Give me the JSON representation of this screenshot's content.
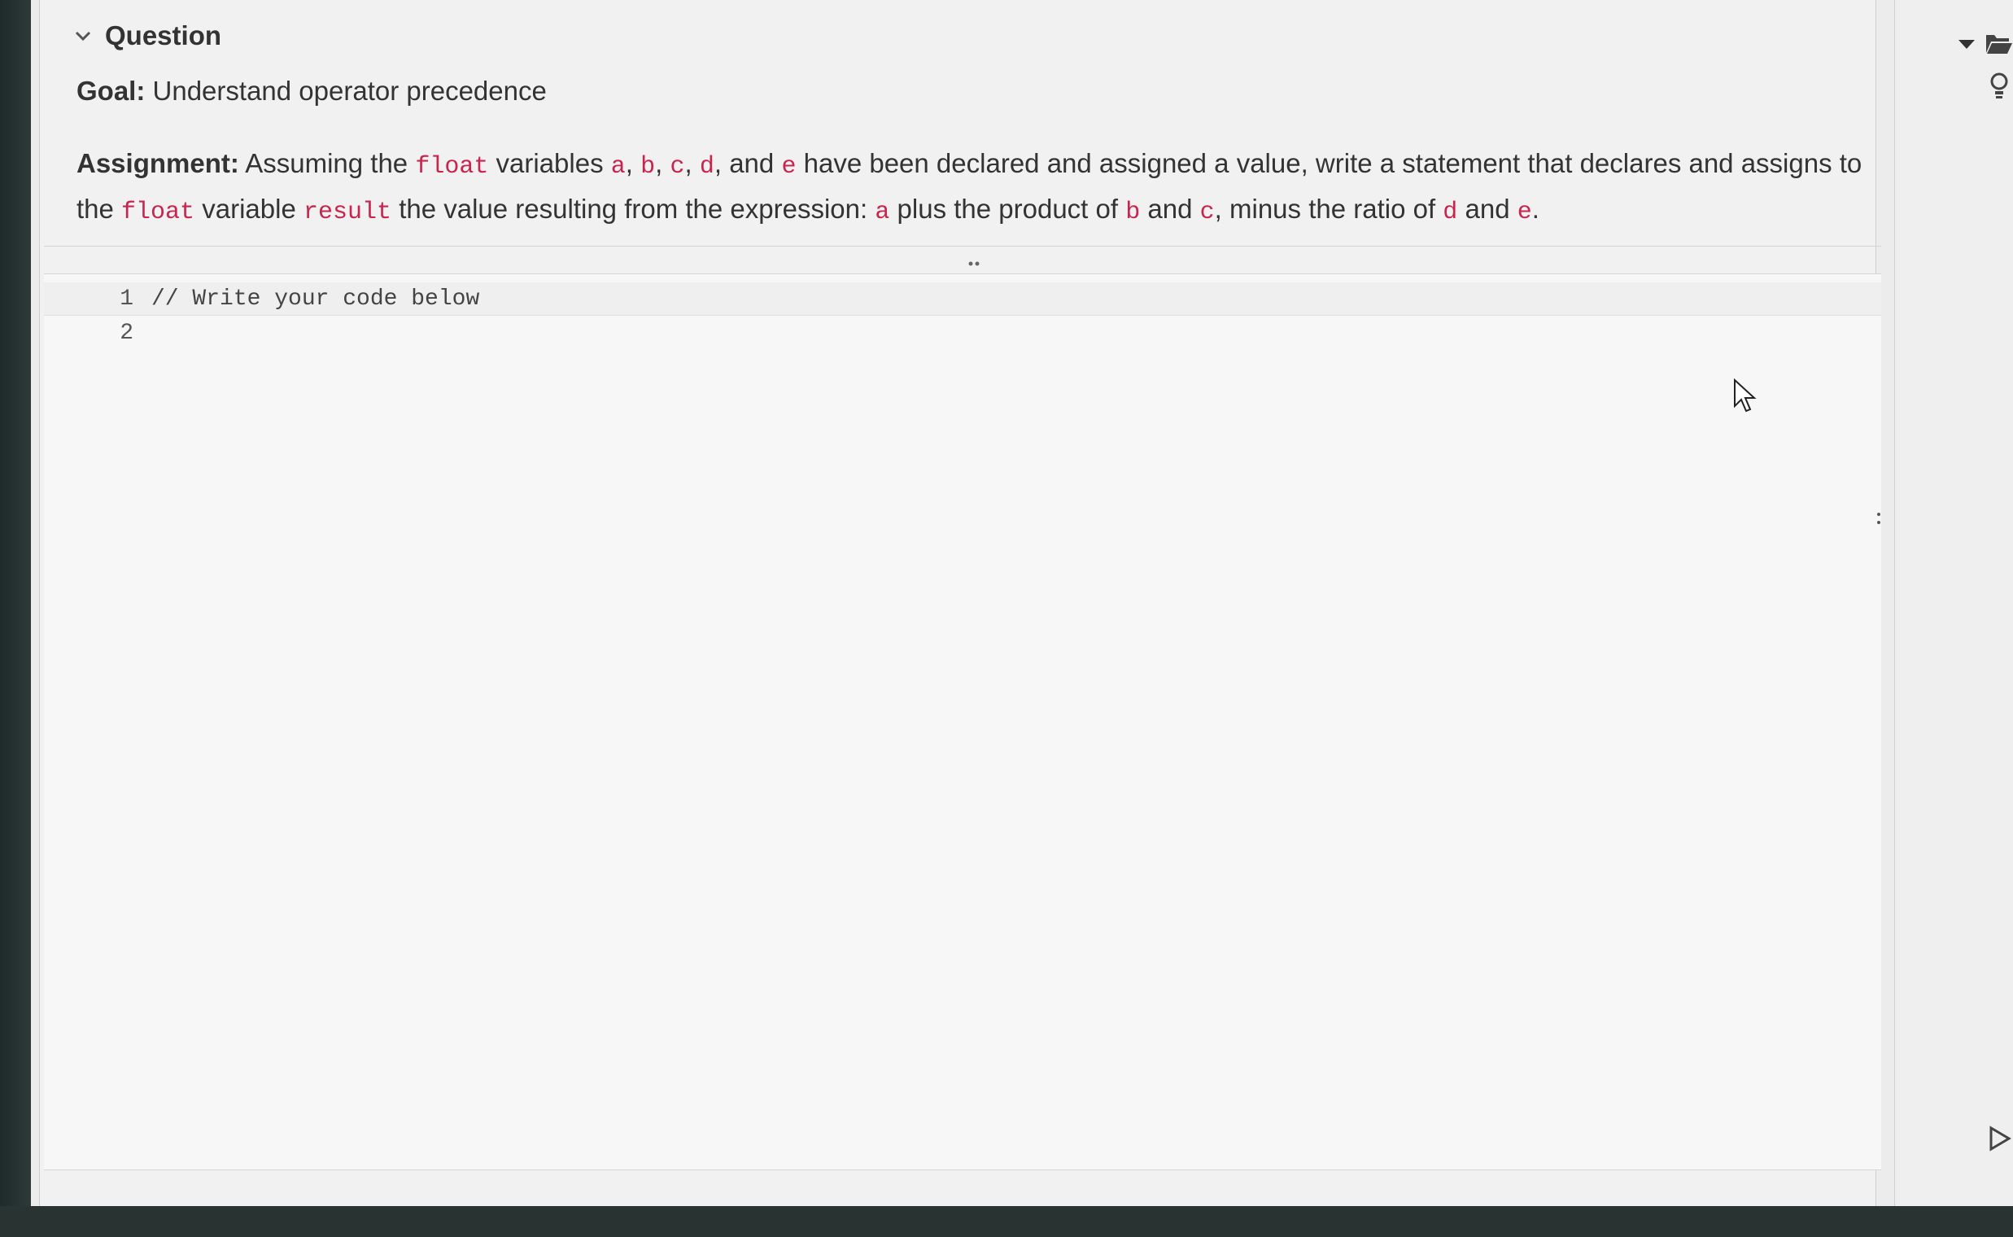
{
  "question": {
    "header": "Question",
    "goal_label": "Goal:",
    "goal_text": "Understand operator precedence",
    "assignment": {
      "label": "Assignment:",
      "t1": "Assuming the",
      "c_float1": "float",
      "t2": "variables",
      "c_a": "a",
      "s1": ",",
      "c_b": "b",
      "s2": ",",
      "c_c": "c",
      "s3": ",",
      "c_d": "d",
      "t3": ", and",
      "c_e": "e",
      "t4": "have been declared and assigned a value, write a statement that declares and assigns to the",
      "c_float2": "float",
      "t5": "variable",
      "c_result": "result",
      "t6": "the value resulting from the expression:",
      "c_a2": "a",
      "t7": "plus the product of",
      "c_b2": "b",
      "t8": "and",
      "c_c2": "c",
      "t9": ", minus the ratio of",
      "c_d2": "d",
      "t10": "and",
      "c_e2": "e",
      "t11": "."
    }
  },
  "editor": {
    "lines": [
      {
        "number": "1",
        "text": "// Write your code below"
      },
      {
        "number": "2",
        "text": ""
      }
    ]
  },
  "side_panel": {
    "icons": [
      "caret-down-icon",
      "folder-open-icon",
      "lightbulb-icon",
      "run-triangle-icon"
    ]
  },
  "colors": {
    "code_accent": "#c7254e",
    "text": "#333333",
    "panel_bg": "#f1f1f1"
  }
}
